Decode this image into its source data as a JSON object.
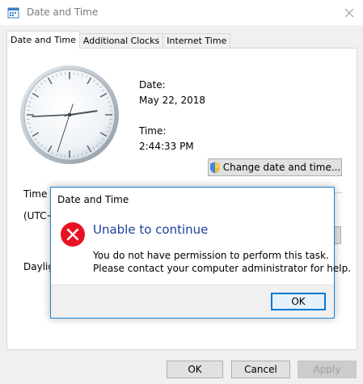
{
  "window": {
    "title": "Date and Time",
    "close_glyph": "✕"
  },
  "tabs": [
    {
      "label": "Date and Time",
      "active": true
    },
    {
      "label": "Additional Clocks",
      "active": false
    },
    {
      "label": "Internet Time",
      "active": false
    }
  ],
  "panel": {
    "date_label": "Date:",
    "date_value": "May 22, 2018",
    "time_label": "Time:",
    "time_value": "2:44:33 PM",
    "change_button": "Change date and time...",
    "timezone_label_partial": "Time z",
    "timezone_value_partial": "(UTC+",
    "daylight_partial": "Dayligh"
  },
  "clock": {
    "hour": 2,
    "minute": 44,
    "second": 33
  },
  "footer": {
    "ok": "OK",
    "cancel": "Cancel",
    "apply": "Apply"
  },
  "dialog": {
    "title": "Date and Time",
    "heading": "Unable to continue",
    "message_line1": "You do not have permission to perform this task.",
    "message_line2": "Please contact your computer administrator for help.",
    "ok": "OK",
    "icon": "error-icon"
  },
  "colors": {
    "dialog_border": "#1883d7",
    "heading": "#1e3f9b",
    "error_red": "#e81123",
    "focus_blue": "#0078d7"
  }
}
